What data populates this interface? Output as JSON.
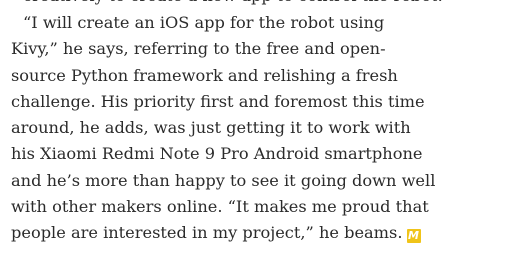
{
  "article": {
    "partial_top_line": "creatively to create a new app to control the robot.",
    "lines": [
      "“I will create an iOS app for the robot using",
      "Kivy,” he says, referring to the free and open-",
      "source Python framework and relishing a fresh",
      "challenge. His priority first and foremost this time",
      "around, he adds, was just getting it to work with",
      "his Xiaomi Redmi Note 9 Pro Android smartphone",
      "and he’s more than happy to see it going down well",
      "with other makers online. “It makes me proud that",
      "people are interested in my project,” he beams."
    ],
    "end_mark": {
      "glyph": "M",
      "color": "#f0c419"
    }
  }
}
